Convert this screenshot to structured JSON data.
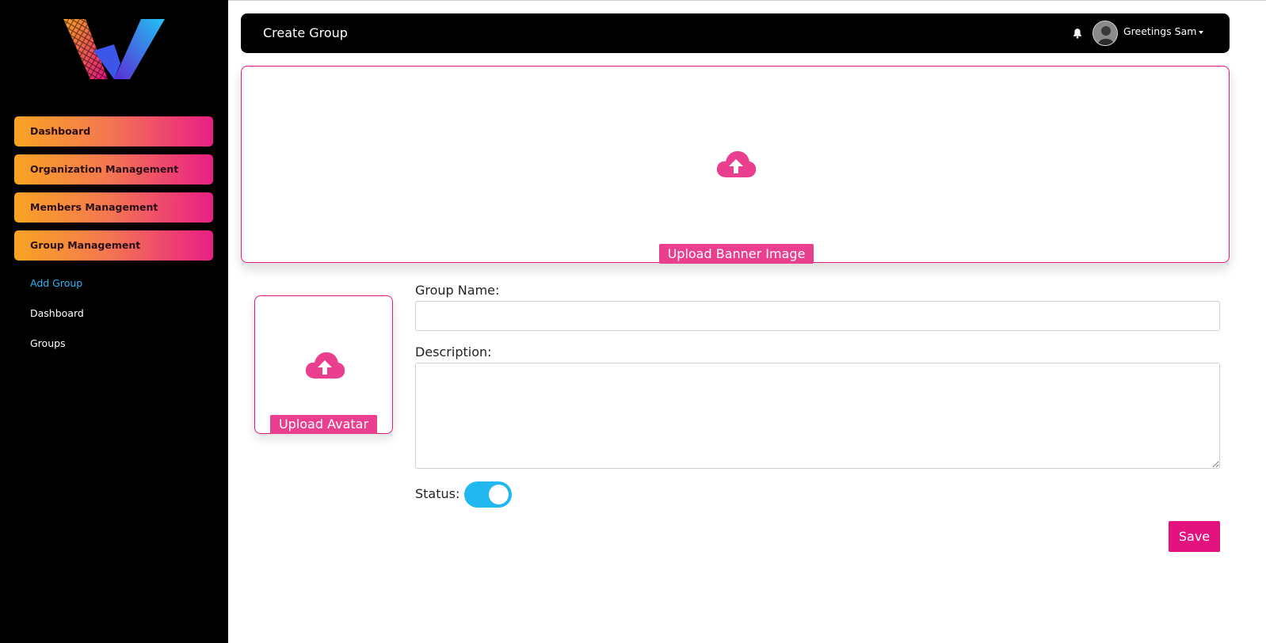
{
  "sidebar": {
    "nav_items": [
      {
        "label": "Dashboard"
      },
      {
        "label": "Organization Management"
      },
      {
        "label": "Members Management"
      },
      {
        "label": "Group Management"
      }
    ],
    "sub_items": [
      {
        "label": "Add Group",
        "active": true
      },
      {
        "label": "Dashboard",
        "active": false
      },
      {
        "label": "Groups",
        "active": false
      }
    ]
  },
  "header": {
    "title": "Create Group",
    "greeting": "Greetings Sam"
  },
  "banner_upload": {
    "label": "Upload Banner Image",
    "icon": "cloud-upload-icon"
  },
  "avatar_upload": {
    "label": "Upload Avatar",
    "icon": "cloud-upload-icon"
  },
  "form": {
    "group_name_label": "Group Name:",
    "group_name_value": "",
    "description_label": "Description:",
    "description_value": "",
    "status_label": "Status:",
    "status_on": true,
    "save_label": "Save"
  },
  "colors": {
    "accent_pink": "#e2127f",
    "toggle_blue": "#21b8f0",
    "gradient_start": "#f9a323",
    "gradient_end": "#ea1f86"
  }
}
